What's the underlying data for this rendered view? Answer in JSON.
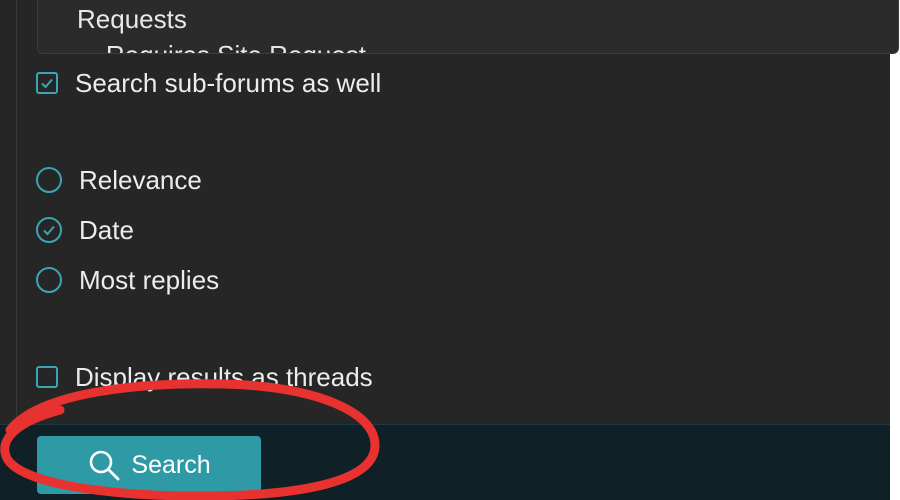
{
  "forum_select": {
    "options": [
      "Requests",
      "- Requires Site Request"
    ]
  },
  "options": {
    "sub_forums": {
      "label": "Search sub-forums as well",
      "checked": true
    },
    "sort_by": [
      {
        "label": "Relevance",
        "selected": false
      },
      {
        "label": "Date",
        "selected": true
      },
      {
        "label": "Most replies",
        "selected": false
      }
    ],
    "threads": {
      "label": "Display results as threads",
      "checked": false
    }
  },
  "footer": {
    "search_label": "Search",
    "search_icon": "magnifier-icon"
  },
  "colors": {
    "panel_bg": "#262626",
    "accent": "#3aa5b5",
    "button_bg": "#2d9aa6",
    "footer_bg": "#0f2027",
    "annotation": "#e8322f"
  }
}
